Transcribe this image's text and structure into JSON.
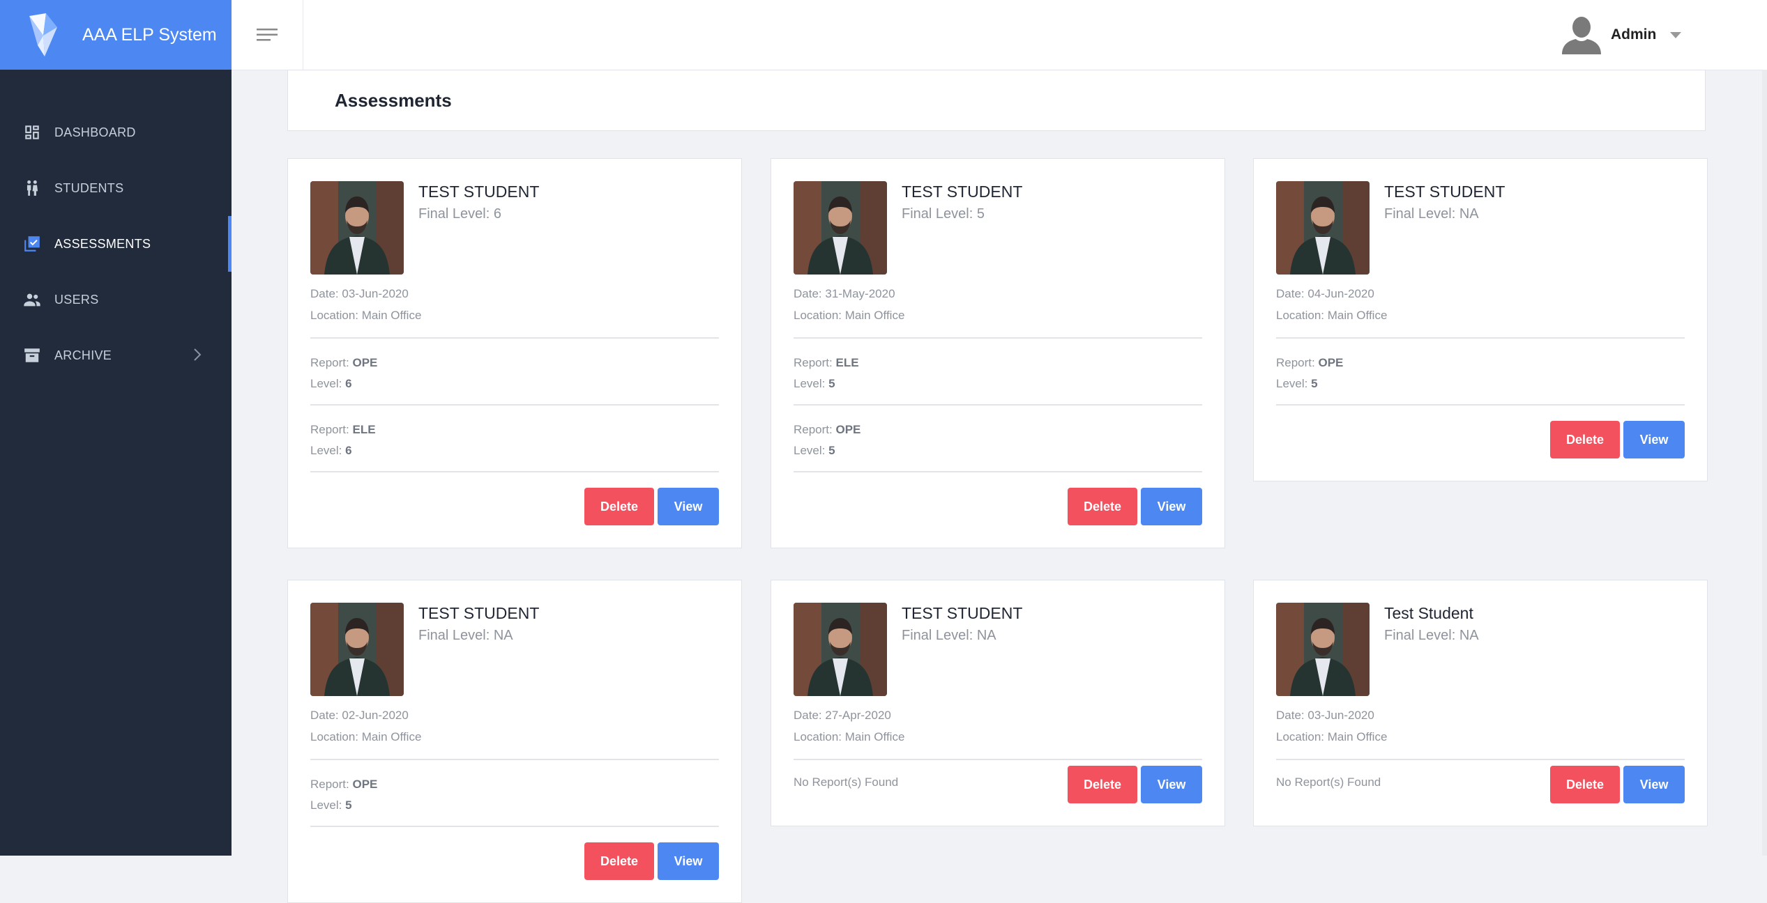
{
  "app": {
    "name": "AAA ELP System"
  },
  "sidebar": {
    "items": [
      {
        "label": "DASHBOARD",
        "icon": "dashboard-icon"
      },
      {
        "label": "STUDENTS",
        "icon": "students-icon"
      },
      {
        "label": "ASSESSMENTS",
        "icon": "assessments-icon",
        "active": true
      },
      {
        "label": "USERS",
        "icon": "users-icon"
      },
      {
        "label": "ARCHIVE",
        "icon": "archive-icon"
      }
    ]
  },
  "header": {
    "user": "Admin"
  },
  "page": {
    "title": "Assessments"
  },
  "labels": {
    "date_prefix": "Date: ",
    "location_prefix": "Location: ",
    "report_prefix": "Report: ",
    "level_prefix": "Level: ",
    "final_level_prefix": "Final Level: ",
    "no_report": "No Report(s) Found",
    "delete": "Delete",
    "view": "View"
  },
  "cards": [
    {
      "name": "TEST STUDENT",
      "final_level": "6",
      "date": "03-Jun-2020",
      "location": "Main Office",
      "reports": [
        {
          "report": "OPE",
          "level": "6"
        },
        {
          "report": "ELE",
          "level": "6"
        }
      ]
    },
    {
      "name": "TEST STUDENT",
      "final_level": "5",
      "date": "31-May-2020",
      "location": "Main Office",
      "reports": [
        {
          "report": "ELE",
          "level": "5"
        },
        {
          "report": "OPE",
          "level": "5"
        }
      ]
    },
    {
      "name": "TEST STUDENT",
      "final_level": "NA",
      "date": "04-Jun-2020",
      "location": "Main Office",
      "reports": [
        {
          "report": "OPE",
          "level": "5"
        }
      ]
    },
    {
      "name": "TEST STUDENT",
      "final_level": "NA",
      "date": "02-Jun-2020",
      "location": "Main Office",
      "reports": [
        {
          "report": "OPE",
          "level": "5"
        }
      ]
    },
    {
      "name": "TEST STUDENT",
      "final_level": "NA",
      "date": "27-Apr-2020",
      "location": "Main Office",
      "reports": []
    },
    {
      "name": "Test Student",
      "final_level": "NA",
      "date": "03-Jun-2020",
      "location": "Main Office",
      "reports": []
    }
  ],
  "colors": {
    "brand": "#4d87f2",
    "sidebar": "#212b3b",
    "delete": "#f4515f",
    "view": "#4d87f2"
  }
}
